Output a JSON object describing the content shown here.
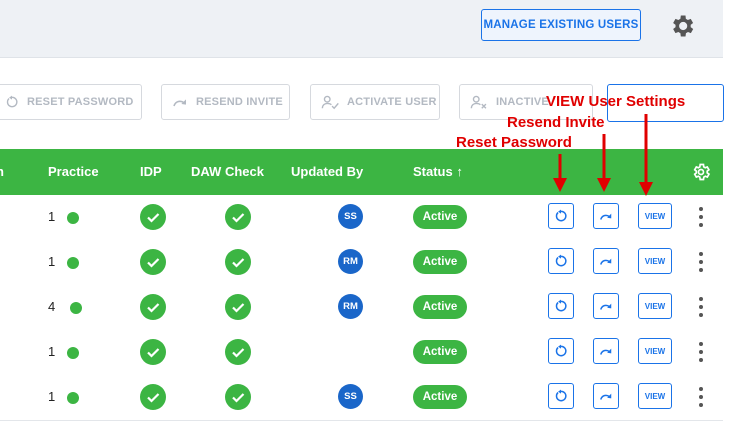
{
  "header": {
    "manage_users_label": "MANAGE EXISTING USERS",
    "settings_icon": "gear-icon"
  },
  "toolbar": {
    "reset_password_label": "RESET PASSWORD",
    "resend_invite_label": "RESEND INVITE",
    "activate_user_label": "ACTIVATE USER",
    "inactivate_label": "INACTIVE",
    "view_settings_label": ""
  },
  "table": {
    "columns": {
      "practice": "Practice",
      "idp": "IDP",
      "daw_check": "DAW Check",
      "updated_by": "Updated By",
      "status": "Status ↑"
    },
    "rows": [
      {
        "practice": "1",
        "updated_by": "SS",
        "status": "Active",
        "view": "VIEW"
      },
      {
        "practice": "1",
        "updated_by": "RM",
        "status": "Active",
        "view": "VIEW"
      },
      {
        "practice": "4",
        "updated_by": "RM",
        "status": "Active",
        "view": "VIEW"
      },
      {
        "practice": "1",
        "updated_by": "",
        "status": "Active",
        "view": "VIEW"
      },
      {
        "practice": "1",
        "updated_by": "SS",
        "status": "Active",
        "view": "VIEW"
      }
    ]
  },
  "annotations": {
    "view_user_settings": "VIEW User Settings",
    "resend_invite": "Resend Invite",
    "reset_password": "Reset Password"
  },
  "colors": {
    "accent_blue": "#1a73e8",
    "header_green": "#3cb543",
    "annotation_red": "#e00000",
    "avatar_blue": "#1a66c9"
  }
}
